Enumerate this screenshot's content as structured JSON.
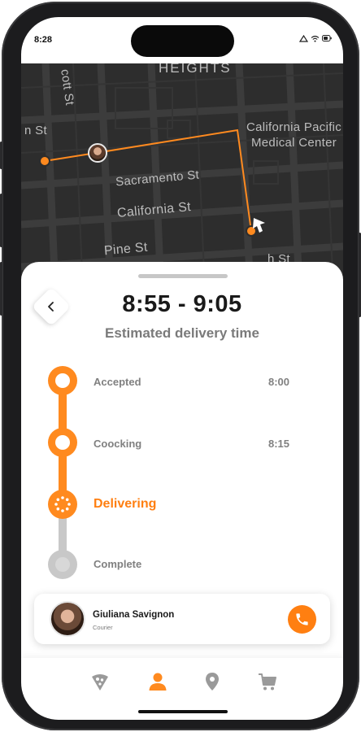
{
  "status_bar": {
    "time": "8:28"
  },
  "map": {
    "streets": [
      "HEIGHTS",
      "cott St",
      "n St",
      "California Pacific",
      "Medical Center",
      "Sacramento St",
      "California St",
      "Pine St",
      "h St"
    ],
    "route_color": "#ff8a1f"
  },
  "order": {
    "eta": "8:55 - 9:05",
    "eta_caption": "Estimated delivery time",
    "steps": [
      {
        "label": "Accepted",
        "time": "8:00",
        "state": "done"
      },
      {
        "label": "Coocking",
        "time": "8:15",
        "state": "done"
      },
      {
        "label": "Delivering",
        "time": "",
        "state": "active"
      },
      {
        "label": "Complete",
        "time": "",
        "state": "pending"
      }
    ]
  },
  "courier": {
    "name": "Giuliana Savignon",
    "role": "Courier"
  },
  "tabs": [
    {
      "icon": "pizza-icon",
      "active": false
    },
    {
      "icon": "user-icon",
      "active": true
    },
    {
      "icon": "location-pin-icon",
      "active": false
    },
    {
      "icon": "cart-icon",
      "active": false
    }
  ],
  "colors": {
    "accent": "#ff8a1f",
    "inactive": "#c8c8c8",
    "text": "#1a1a1a"
  }
}
